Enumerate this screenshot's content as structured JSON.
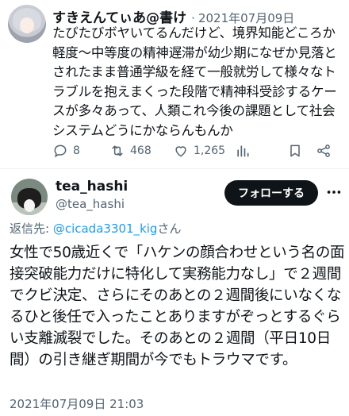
{
  "tweet1": {
    "display_name": "すきえんてぃあ@書け",
    "more": "·",
    "date": "2021年07月09日",
    "text": "たびたびボヤいてるんだけど、境界知能どころか軽度〜中等度の精神遅滞が幼少期になぜか見落とされたまま普通学級を経て一般就労して様々なトラブルを抱えまくった段階で精神科受診するケースが多々あって、人類これ今後の課題として社会システムどうにかならんもんか",
    "replies": "8",
    "retweets": "468",
    "likes": "1,265",
    "icons": [
      "reply-icon",
      "retweet-icon",
      "like-icon",
      "analytics-icon",
      "bookmark-icon",
      "share-icon"
    ]
  },
  "tweet2": {
    "display_name": "tea_hashi",
    "handle": "@tea_hashi",
    "follow_label": "フォローする",
    "reply_prefix": "返信先: ",
    "reply_mention": "@cicada3301_kig",
    "reply_suffix": "さん",
    "text": "女性で50歳近くで「ハケンの顔合わせという名の面接突破能力だけに特化して実務能力なし」で２週間でクビ決定、さらにそのあとの２週間後にいなくなるひと後任で入ったことありますがぞっとするぐらい支離滅裂でした。そのあとの２週間（平日10日間）の引き継ぎ期間が今でもトラウマです。",
    "timestamp": "2021年07月09日 21:03"
  },
  "colors": {
    "text": "#0f1419",
    "secondary": "#536471",
    "link": "#1d9bf0",
    "follow_bg": "#0f1419"
  }
}
